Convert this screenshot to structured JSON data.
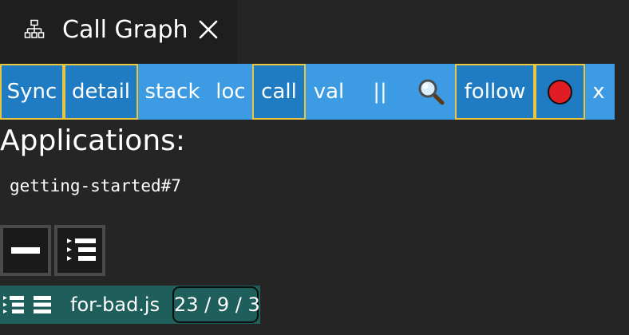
{
  "tab": {
    "title": "Call Graph",
    "icon": "hierarchy-icon",
    "close_icon": "close-icon"
  },
  "toolbar": {
    "sync": "Sync",
    "detail": "detail",
    "stack": "stack",
    "loc": "loc",
    "call": "call",
    "val": "val",
    "pause": "||",
    "search_icon": "magnifier-icon",
    "follow": "follow",
    "record_icon": "record-icon",
    "close": "x",
    "colors": {
      "background": "#3c9be2",
      "active_background": "#1f7cc2",
      "active_border": "#e8c640",
      "record": "#e01c24"
    }
  },
  "content": {
    "heading": "Applications:",
    "app_name": "getting-started#7",
    "collapse_icon": "collapse-minus-icon",
    "expand_icon": "expand-tree-icon"
  },
  "file_row": {
    "expand_icon": "expand-tree-icon",
    "list_icon": "list-icon",
    "file_name": "for-bad.js",
    "counts": "23 / 9 / 3",
    "background": "#1e5f5c"
  }
}
